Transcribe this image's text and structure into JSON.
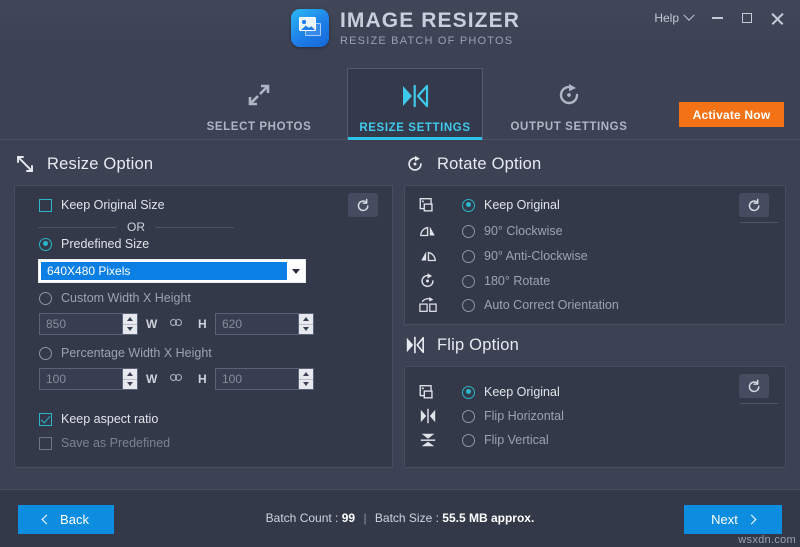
{
  "window": {
    "app_title": "IMAGE RESIZER",
    "app_subtitle": "RESIZE BATCH OF PHOTOS",
    "help_label": "Help",
    "minimize_label": "Minimize",
    "maximize_label": "Maximize",
    "close_label": "Close"
  },
  "tabs": [
    {
      "label": "SELECT PHOTOS",
      "icon": "expand-arrows-icon",
      "active": false
    },
    {
      "label": "RESIZE SETTINGS",
      "icon": "resize-flip-icon",
      "active": true
    },
    {
      "label": "OUTPUT SETTINGS",
      "icon": "rotate-cw-icon",
      "active": false
    }
  ],
  "activate_button": {
    "label": "Activate Now",
    "color": "#f47216"
  },
  "resize_section": {
    "title": "Resize Option",
    "icon": "diagonal-resize-icon",
    "reset_icon": "reset-icon",
    "keep_original_size": {
      "label": "Keep Original Size",
      "checked": false
    },
    "or_label": "OR",
    "predefined_size": {
      "label": "Predefined Size",
      "selected": true
    },
    "dropdown": {
      "value": "640X480 Pixels",
      "icon": "chevron-down-icon"
    },
    "custom_wh": {
      "label": "Custom Width X Height",
      "selected": false
    },
    "custom_width": {
      "value": "850",
      "unit_label": "W"
    },
    "custom_height": {
      "value": "620",
      "unit_label": "H"
    },
    "percentage_wh": {
      "label": "Percentage Width X Height",
      "selected": false
    },
    "percent_width": {
      "value": "100",
      "unit_label": "W"
    },
    "percent_height": {
      "value": "100",
      "unit_label": "H"
    },
    "keep_aspect_ratio": {
      "label": "Keep aspect ratio",
      "checked": true
    },
    "save_as_predefined": {
      "label": "Save as Predefined",
      "checked": false
    }
  },
  "rotate_section": {
    "title": "Rotate Option",
    "icon": "rotate-cw-icon",
    "reset_icon": "reset-icon",
    "options": [
      {
        "label": "Keep Original",
        "icon": "image-original-icon",
        "selected": true
      },
      {
        "label": "90° Clockwise",
        "icon": "rotate-90-cw-icon",
        "selected": false
      },
      {
        "label": "90° Anti-Clockwise",
        "icon": "rotate-90-ccw-icon",
        "selected": false
      },
      {
        "label": "180° Rotate",
        "icon": "rotate-180-icon",
        "selected": false
      },
      {
        "label": "Auto Correct Orientation",
        "icon": "auto-orient-icon",
        "selected": false
      }
    ]
  },
  "flip_section": {
    "title": "Flip Option",
    "icon": "flip-icon",
    "reset_icon": "reset-icon",
    "options": [
      {
        "label": "Keep Original",
        "icon": "image-original-icon",
        "selected": true
      },
      {
        "label": "Flip Horizontal",
        "icon": "flip-h-icon",
        "selected": false
      },
      {
        "label": "Flip Vertical",
        "icon": "flip-v-icon",
        "selected": false
      }
    ]
  },
  "footer": {
    "back_label": "Back",
    "next_label": "Next",
    "batch_count_label": "Batch Count :",
    "batch_count_value": "99",
    "separator": "|",
    "batch_size_label": "Batch Size :",
    "batch_size_value": "55.5 MB approx.",
    "watermark": "wsxdn.com"
  }
}
